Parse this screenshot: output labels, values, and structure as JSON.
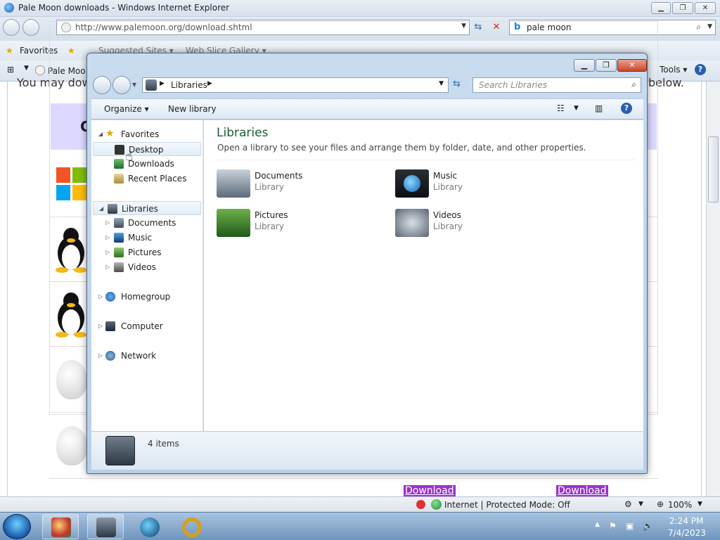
{
  "ie": {
    "window_title": "Pale Moon downloads - Windows Internet Explorer",
    "url": "http://www.palemoon.org/download.shtml",
    "search_engine_glyph": "b",
    "search_query": "pale moon",
    "favorites_label": "Favorites",
    "suggested_sites_label": "Suggested Sites ▾",
    "web_slice_label": "Web Slice Gallery ▾",
    "tab_label": "Pale Moo",
    "tools_label": "Tools ▾",
    "help_glyph": "?",
    "status_text": "Internet | Protected Mode: Off",
    "zoom": "100%"
  },
  "page": {
    "frag_left": "You may dow",
    "frag_right": "below.",
    "frag_heading": "C",
    "download_label": "Download"
  },
  "explorer": {
    "breadcrumb": "Libraries",
    "search_placeholder": "Search Libraries",
    "organize_label": "Organize ▾",
    "new_library_label": "New library",
    "nav": {
      "favorites": "Favorites",
      "desktop": "Desktop",
      "downloads": "Downloads",
      "recent_places": "Recent Places",
      "libraries": "Libraries",
      "documents": "Documents",
      "music": "Music",
      "pictures": "Pictures",
      "videos": "Videos",
      "homegroup": "Homegroup",
      "computer": "Computer",
      "network": "Network"
    },
    "content_title": "Libraries",
    "content_subtitle": "Open a library to see your files and arrange them by folder, date, and other properties.",
    "libraries": [
      {
        "name": "Documents",
        "type": "Library"
      },
      {
        "name": "Music",
        "type": "Library"
      },
      {
        "name": "Pictures",
        "type": "Library"
      },
      {
        "name": "Videos",
        "type": "Library"
      }
    ],
    "item_count": "4 items"
  },
  "taskbar": {
    "time": "2:24 PM",
    "date": "7/4/2023"
  },
  "colors": {
    "library_title": "#1e5a34",
    "download_button": "#9932cc"
  }
}
